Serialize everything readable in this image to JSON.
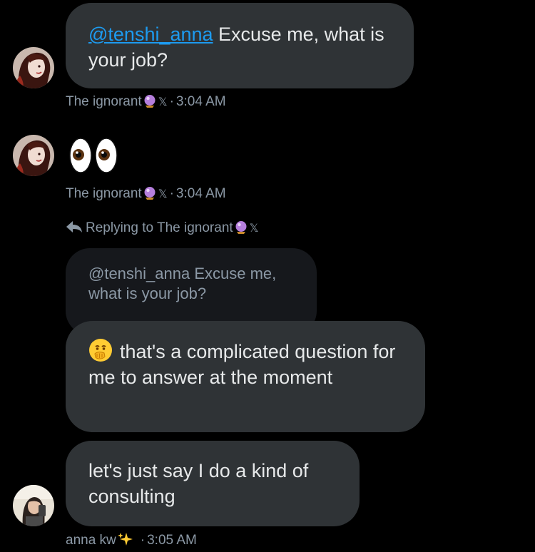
{
  "messages": [
    {
      "mention": "@tenshi_anna",
      "text": " Excuse me, what is your job?",
      "sender": "The ignorant",
      "time": "3:04 AM"
    },
    {
      "emoji": "eyes-emoji",
      "sender": "The ignorant",
      "time": "3:04 AM"
    },
    {
      "replying_to_label": "Replying to The ignorant",
      "quoted_text": "@tenshi_anna Excuse me, what is your job?",
      "text": "that's a complicated question for me to answer at the moment",
      "emoji": "face-with-hand-over-mouth-emoji"
    },
    {
      "text": "let's just say I do a kind of consulting",
      "sender": "anna kw",
      "time": "3:05 AM"
    }
  ],
  "separator": "·",
  "x_badge": "𝕏",
  "colors": {
    "background": "#000000",
    "bubble": "#2f3336",
    "quoted_bubble": "#16181c",
    "mention": "#1d9bf0",
    "meta_text": "#8b98a5",
    "message_text": "#e7e9ea"
  }
}
